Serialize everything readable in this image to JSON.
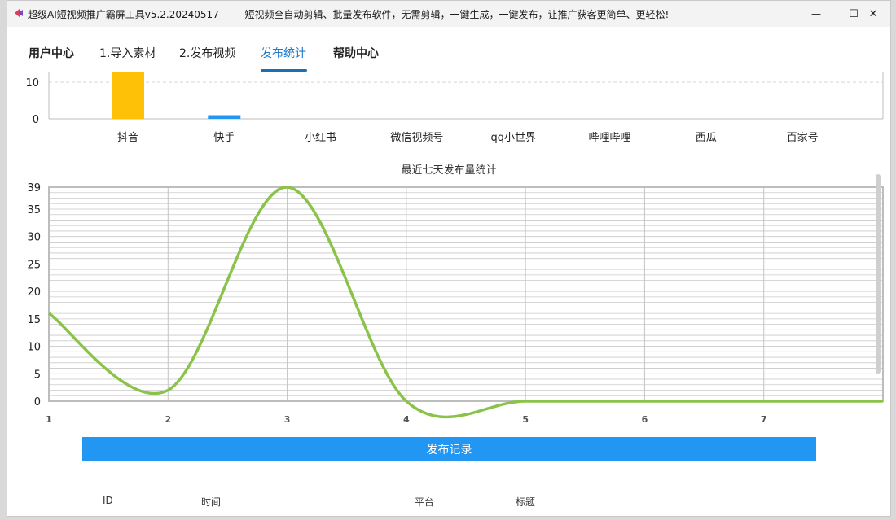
{
  "window": {
    "title": "超级AI短视频推广霸屏工具v5.2.20240517 —— 短视频全自动剪辑、批量发布软件，无需剪辑，一键生成，一键发布，让推广获客更简单、更轻松!",
    "controls": {
      "minimize": "—",
      "maximize": "☐",
      "close": "✕"
    }
  },
  "tabs": [
    {
      "label": "用户中心",
      "bold": true
    },
    {
      "label": "1.导入素材",
      "bold": false
    },
    {
      "label": "2.发布视频",
      "bold": false
    },
    {
      "label": "发布统计",
      "active": true
    },
    {
      "label": "帮助中心",
      "bold": true
    }
  ],
  "chart_data": [
    {
      "type": "bar",
      "title": "",
      "categories": [
        "抖音",
        "快手",
        "小红书",
        "微信视频号",
        "qq小世界",
        "哔哩哔哩",
        "西瓜",
        "百家号"
      ],
      "values": [
        13,
        1,
        0,
        0,
        0,
        0,
        0,
        0
      ],
      "colors": [
        "#ffc107",
        "#2196f3",
        "#2196f3",
        "#2196f3",
        "#2196f3",
        "#2196f3",
        "#2196f3",
        "#2196f3"
      ],
      "visible_ticks": [
        "0",
        "10"
      ],
      "note_visible_range": "top of chart is cut off; 10 and 0 tick labels visible",
      "grid": "dashed horizontal line at 10"
    },
    {
      "type": "line",
      "title": "最近七天发布量统计",
      "x": [
        1,
        2,
        3,
        4,
        5,
        6,
        7
      ],
      "series": [
        {
          "values": [
            16,
            2,
            39,
            0,
            0,
            0,
            0
          ],
          "color": "#8bc34a",
          "smooth": true
        }
      ],
      "yticks": [
        "0",
        "5",
        "10",
        "15",
        "20",
        "25",
        "30",
        "35",
        "39"
      ],
      "xticks": [
        "1",
        "2",
        "3",
        "4",
        "5",
        "6",
        "7"
      ],
      "ylim": [
        0,
        39
      ],
      "xlim": [
        1,
        8
      ],
      "grid": true
    }
  ],
  "records": {
    "button_label": "发布记录",
    "columns": [
      "ID",
      "时间",
      "平台",
      "标题"
    ]
  }
}
